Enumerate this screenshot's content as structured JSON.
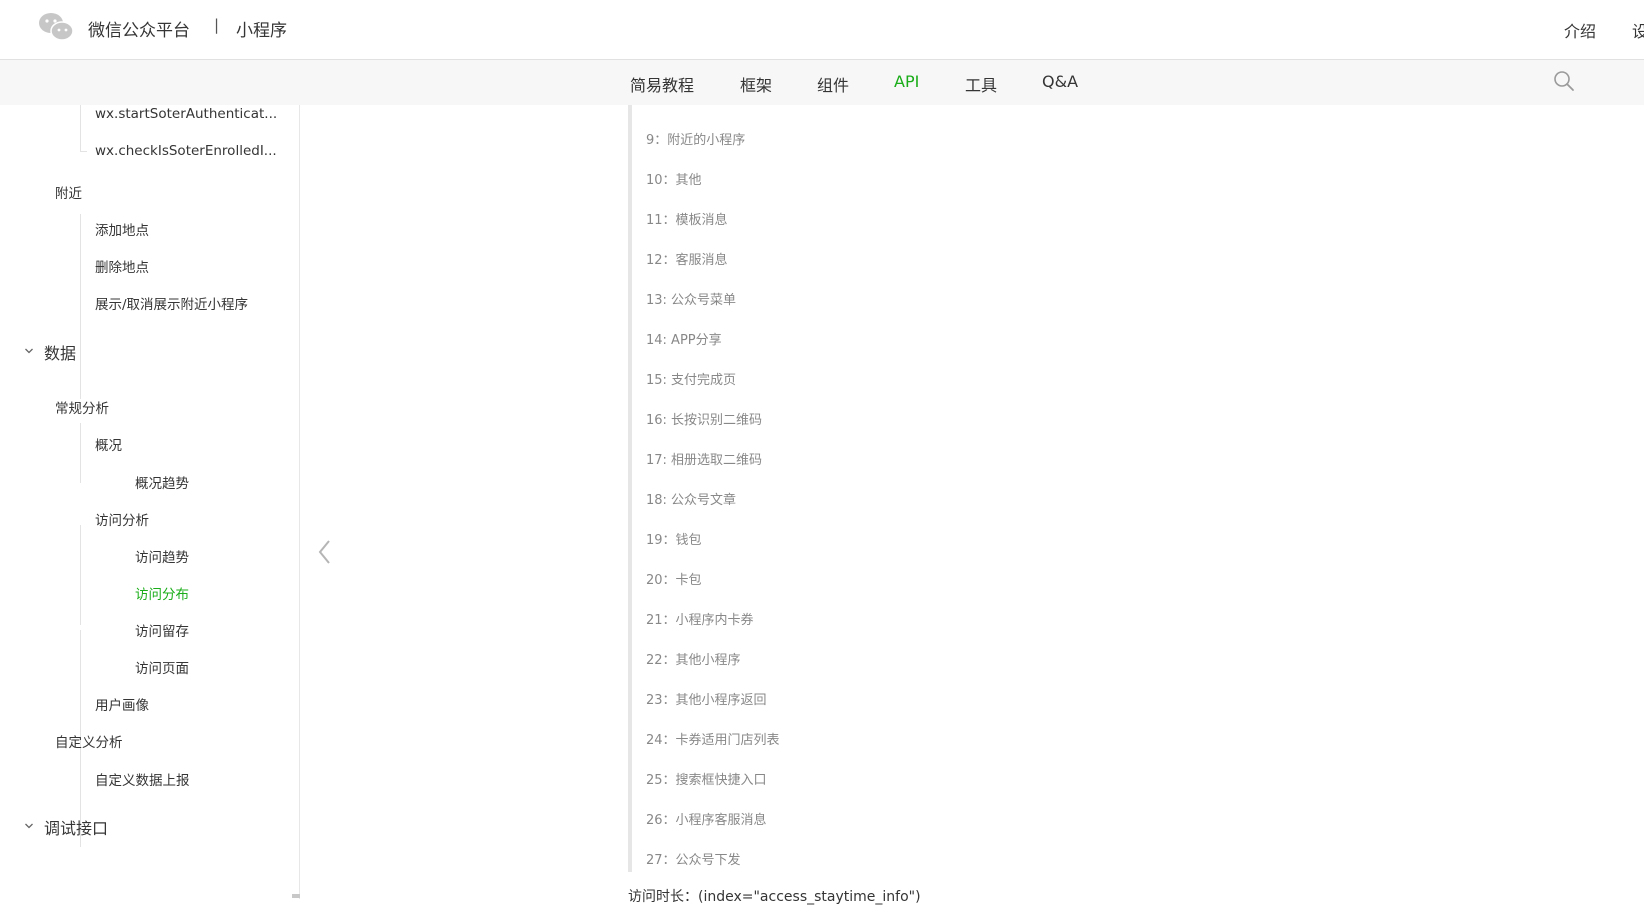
{
  "header": {
    "brand": "微信公众平台",
    "separator": "|",
    "product": "小程序",
    "links": [
      "介绍",
      "设"
    ]
  },
  "nav": {
    "items": [
      "简易教程",
      "框架",
      "组件",
      "API",
      "工具",
      "Q&A"
    ],
    "active": "API",
    "accent_color": "#1aad19"
  },
  "sidebar": {
    "items": [
      "wx.startSoterAuthenticat...",
      "wx.checkIsSoterEnrolledI...",
      "附近",
      "添加地点",
      "删除地点",
      "展示/取消展示附近小程序",
      "常规分析",
      "概况",
      "概况趋势",
      "访问分析",
      "访问趋势",
      "访问分布",
      "访问留存",
      "访问页面",
      "用户画像",
      "自定义分析",
      "自定义数据上报"
    ],
    "sections": [
      "数据",
      "调试接口"
    ],
    "active_item": "访问分布"
  },
  "content": {
    "lines": [
      "9：附近的小程序",
      "10：其他",
      "11：模板消息",
      "12：客服消息",
      "13: 公众号菜单",
      "14: APP分享",
      "15: 支付完成页",
      "16: 长按识别二维码",
      "17: 相册选取二维码",
      "18: 公众号文章",
      "19：钱包",
      "20：卡包",
      "21：小程序内卡券",
      "22：其他小程序",
      "23：其他小程序返回",
      "24：卡券适用门店列表",
      "25：搜索框快捷入口",
      "26：小程序客服消息",
      "27：公众号下发"
    ],
    "bottom_text": "访问时长：(index=\"access_staytime_info\")"
  }
}
